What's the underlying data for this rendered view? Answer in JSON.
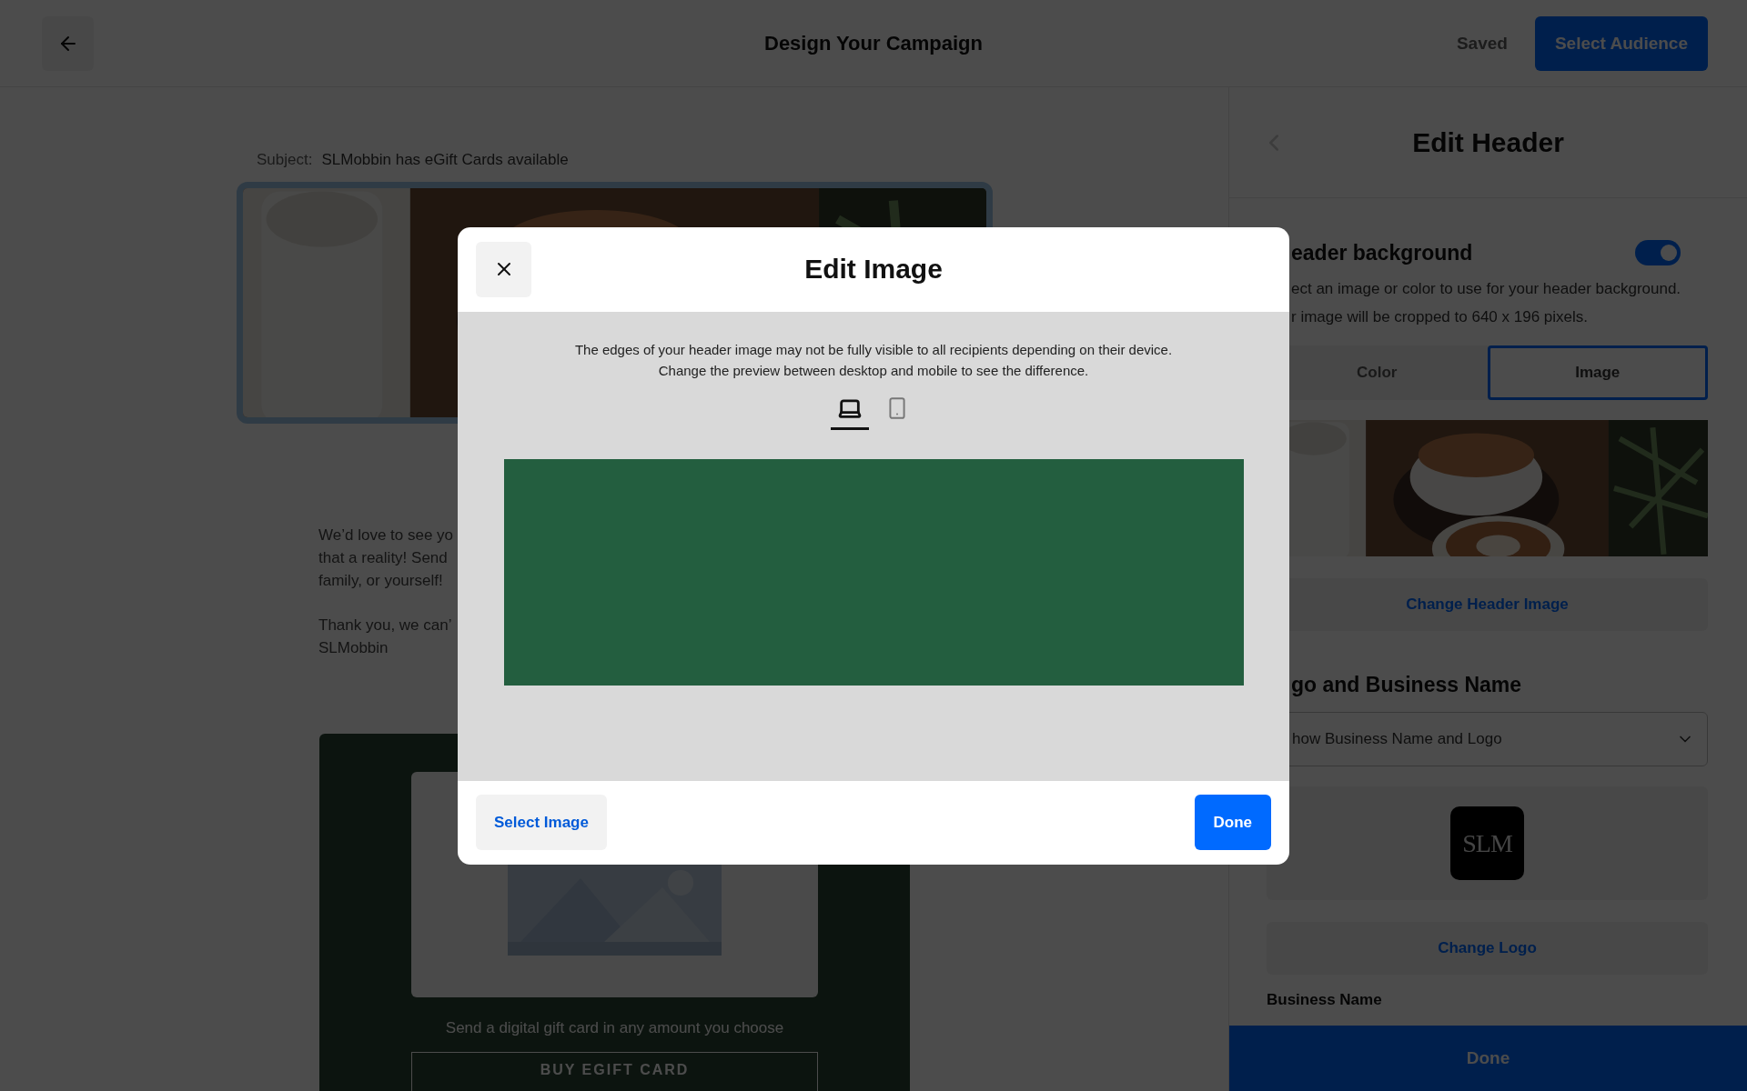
{
  "top_bar": {
    "title": "Design Your Campaign",
    "status": "Saved",
    "primary_button": "Select Audience"
  },
  "email": {
    "subject_label": "Subject:",
    "subject": "SLMobbin has eGift Cards available",
    "header_image": {
      "kind": "picture",
      "selected": true
    },
    "paragraphs": [
      {
        "lines": [
          "We’d love to see yo",
          "that a reality! Send",
          "family, or yourself!"
        ]
      },
      {
        "lines": [
          "Thank you, we can’",
          "SLMobbin"
        ]
      }
    ],
    "gift_card": {
      "caption": "Send a digital gift card in any amount you choose",
      "button": "BUY EGIFT CARD"
    }
  },
  "side_panel": {
    "title": "Edit Header",
    "header_background": {
      "title": "eader background",
      "on": true,
      "description_lines": [
        "ect an image or color to use for your header background.",
        "r image will be cropped to 640 x 196 pixels."
      ]
    },
    "source_tabs": [
      {
        "label": "Color",
        "selected": false
      },
      {
        "label": "Image",
        "selected": true
      }
    ],
    "change_image_button": "Change Header Image",
    "logo_section": {
      "title": "go and Business Name",
      "select_value": "how Business Name and Logo",
      "logo_text": "SLM",
      "change_logo_button": "Change Logo",
      "field_label": "Business Name"
    },
    "done_button": "Done"
  },
  "modal": {
    "title": "Edit Image",
    "note": "The edges of your header image may not be fully visible to all recipients depending on their device. Change the preview between desktop and mobile to see the difference.",
    "devices": [
      {
        "kind": "desktop",
        "selected": true
      },
      {
        "kind": "mobile",
        "selected": false
      }
    ],
    "select_button": "Select Image",
    "done_button": "Done"
  }
}
